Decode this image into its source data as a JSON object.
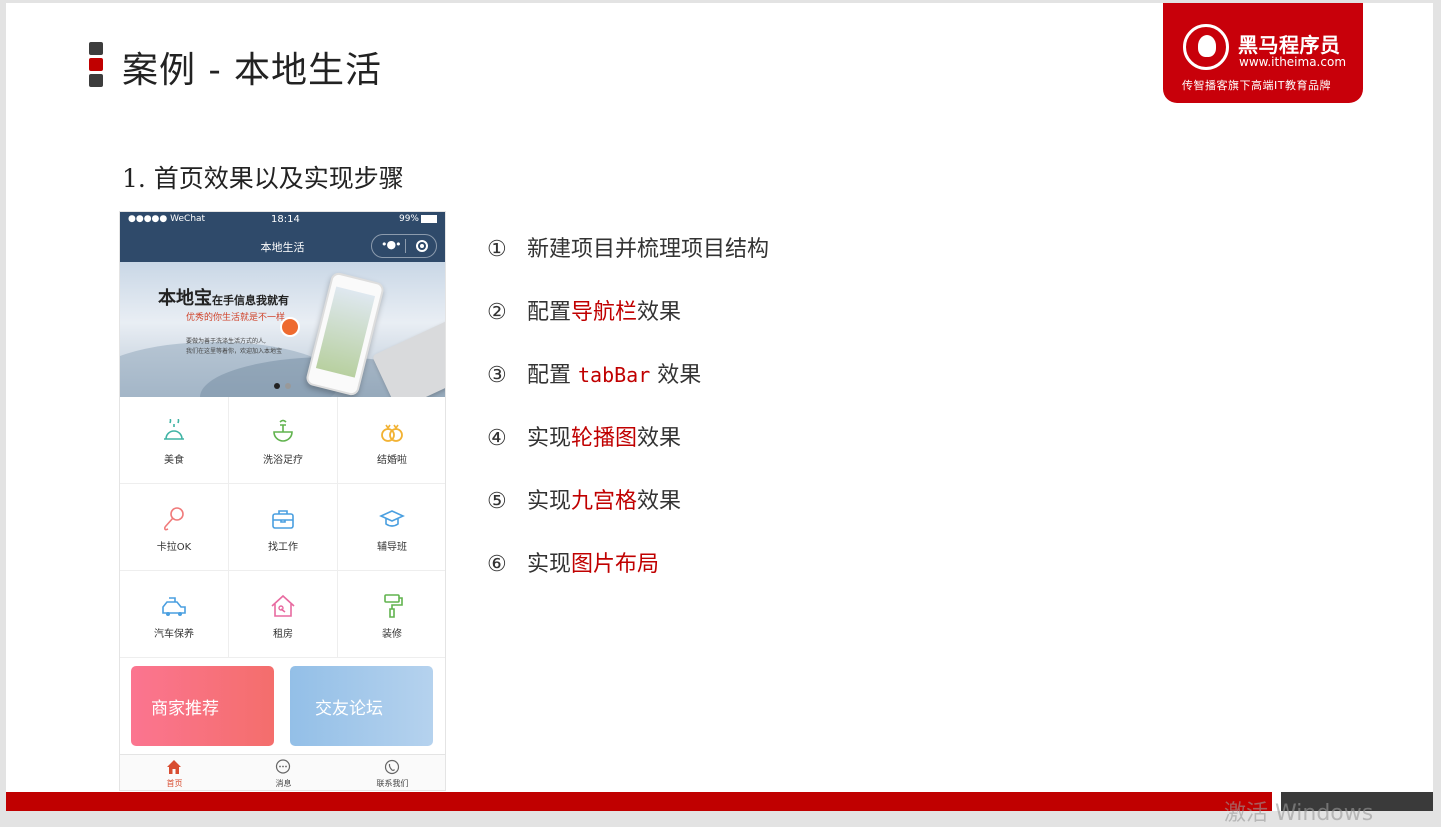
{
  "slide": {
    "title": "案例 - 本地生活",
    "subtitle": "1. 首页效果以及实现步骤"
  },
  "logo": {
    "brand": "黑马程序员",
    "url": "www.itheima.com",
    "slogan": "传智播客旗下高端IT教育品牌"
  },
  "phone": {
    "status": {
      "signal": "●●●●● WeChat",
      "time": "18:14",
      "battery": "99%"
    },
    "app_title": "本地生活",
    "banner": {
      "headline": "本地宝",
      "headline_small": "在手信息我就有",
      "tagline": "优秀的你生活就是不一样",
      "desc_line1": "要做为善于洗涤生活方式的人,",
      "desc_line2": "我们在这里等着你，欢迎加入本地宝"
    },
    "grid": [
      {
        "label": "美食",
        "icon": "food-icon",
        "color": "#3fb3a4"
      },
      {
        "label": "洗浴足疗",
        "icon": "bath-icon",
        "color": "#61b34e"
      },
      {
        "label": "结婚啦",
        "icon": "rings-icon",
        "color": "#f2b233"
      },
      {
        "label": "卡拉OK",
        "icon": "microphone-icon",
        "color": "#f07b7b"
      },
      {
        "label": "找工作",
        "icon": "briefcase-icon",
        "color": "#4a9fe0"
      },
      {
        "label": "辅导班",
        "icon": "graduation-cap-icon",
        "color": "#4a9fe0"
      },
      {
        "label": "汽车保养",
        "icon": "car-icon",
        "color": "#4a9fe0"
      },
      {
        "label": "租房",
        "icon": "house-icon",
        "color": "#e86aa0"
      },
      {
        "label": "装修",
        "icon": "paint-roller-icon",
        "color": "#61b34e"
      }
    ],
    "cards": {
      "left": "商家推荐",
      "right": "交友论坛"
    },
    "tabs": [
      {
        "label": "首页",
        "icon": "home-icon"
      },
      {
        "label": "消息",
        "icon": "message-icon"
      },
      {
        "label": "联系我们",
        "icon": "phone-icon"
      }
    ]
  },
  "steps": [
    {
      "num": "①",
      "pre": "新建项目并梳理项目结构",
      "hl": "",
      "post": ""
    },
    {
      "num": "②",
      "pre": "配置",
      "hl": "导航栏",
      "post": "效果"
    },
    {
      "num": "③",
      "pre": "配置 ",
      "code": "tabBar",
      "post": " 效果"
    },
    {
      "num": "④",
      "pre": "实现",
      "hl": "轮播图",
      "post": "效果"
    },
    {
      "num": "⑤",
      "pre": "实现",
      "hl": "九宫格",
      "post": "效果"
    },
    {
      "num": "⑥",
      "pre": "实现",
      "hl": "图片布局",
      "post": ""
    }
  ],
  "watermark": "激活 Windows"
}
